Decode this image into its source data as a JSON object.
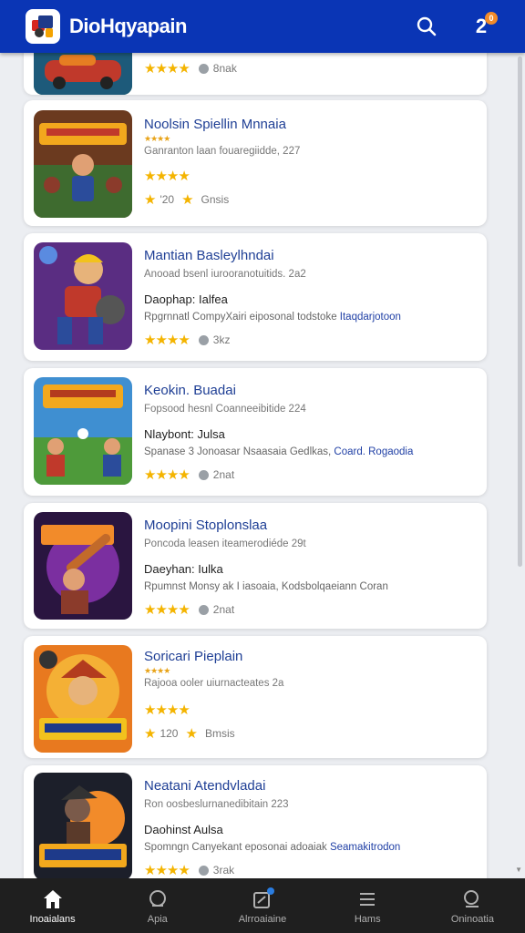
{
  "header": {
    "title": "DioHqyapain",
    "notification_count": "2",
    "notification_badge": "0",
    "brand_color": "#0a35b5"
  },
  "apps": [
    {
      "name": "",
      "meta": "",
      "tag": "",
      "desc": "",
      "desc_link": "",
      "stars": "★★★★",
      "downloads": "8nak",
      "count": "",
      "count_label": ""
    },
    {
      "name": "Noolsin Spiellin Mnnaia",
      "small_stars": "★★★★",
      "meta": "Ganranton laan fouaregiidde, 227",
      "tag": "",
      "desc": "",
      "desc_link": "",
      "stars": "★★★★",
      "downloads": "",
      "count": "'20",
      "count_label": "Gnsis"
    },
    {
      "name": "Mantian Basleylhndai",
      "meta": "Anooad bsenl iurooranotuitids. 2a2",
      "tag": "Daophap: Ialfea",
      "desc": "Rpgrnnatl CompyXairi eiposonal todstoke ",
      "desc_link": "Itaqdarjotoon",
      "stars": "★★★★",
      "downloads": "3kz"
    },
    {
      "name": "Keokin. Buadai",
      "meta": "Fopsood hesnl Coanneeibitide  224",
      "tag": "Nlaybont: Julsa",
      "desc": "Spanase 3 Jonoasar Nsaasaia Gedlkas, ",
      "desc_link": "Coard. Rogaodia",
      "stars": "★★★★",
      "downloads": "2nat"
    },
    {
      "name": "Moopini Stoplonslaa",
      "meta": "Poncoda leasen iteamerodiéde  29t",
      "tag": "Daeyhan: Iulka",
      "desc": "Rpumnst Monsy ak I iasoaia, Kodsbolqaeiann Coran",
      "desc_link": "",
      "stars": "★★★★",
      "downloads": "2nat"
    },
    {
      "name": "Soricari Pieplain",
      "small_stars": "★★★★",
      "meta": "Rajooa ooler uiurnacteates 2a",
      "tag": "",
      "desc": "",
      "desc_link": "",
      "stars": "★★★★",
      "downloads": "",
      "count": "120",
      "count_label": "Bmsis"
    },
    {
      "name": "Neatani Atendvladai",
      "meta": "Ron oosbeslurnanedibitain  223",
      "tag": "Daohinst Aulsa",
      "desc": "Spomngn Canyekant eposonai adoaiak ",
      "desc_link": "Seamakitrodon",
      "stars": "★★★★",
      "downloads": "3rak"
    }
  ],
  "nav": [
    {
      "label": "Inoaialans",
      "icon": "home-icon"
    },
    {
      "label": "Apia",
      "icon": "apps-icon"
    },
    {
      "label": "Alrroaiaine",
      "icon": "updates-icon"
    },
    {
      "label": "Hams",
      "icon": "menu-icon"
    },
    {
      "label": "Oninoatia",
      "icon": "search-icon"
    }
  ]
}
